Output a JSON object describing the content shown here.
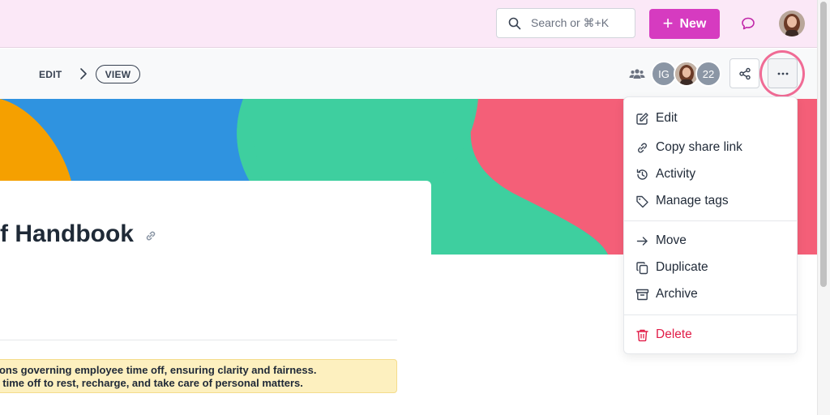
{
  "header": {
    "search_placeholder": "Search or ⌘+K",
    "new_label": "New"
  },
  "breadcrumb": {
    "edit_label": "EDIT",
    "view_label": "VIEW"
  },
  "collaborators": {
    "initials": "IG",
    "count": "22"
  },
  "document": {
    "title": "f Handbook",
    "callout_line1": "tions governing employee time off, ensuring clarity and fairness.",
    "callout_line2": "ir time off to rest, recharge, and take care of personal matters."
  },
  "menu": {
    "items": [
      {
        "label": "Edit",
        "icon": "pencil-square-icon"
      },
      {
        "label": "Copy share link",
        "icon": "link-icon"
      },
      {
        "label": "Activity",
        "icon": "history-icon"
      },
      {
        "label": "Manage tags",
        "icon": "tag-icon"
      },
      {
        "label": "Move",
        "icon": "arrow-right-icon"
      },
      {
        "label": "Duplicate",
        "icon": "duplicate-icon"
      },
      {
        "label": "Archive",
        "icon": "archive-icon"
      },
      {
        "label": "Delete",
        "icon": "trash-icon"
      }
    ]
  },
  "colors": {
    "brand_pink": "#d63bc0",
    "topbar_bg": "#fbe8f7",
    "banner_blue": "#2f93e0",
    "banner_green": "#3ecf9f",
    "banner_red": "#f45f78",
    "banner_orange": "#f5a000",
    "danger": "#e11d48",
    "callout_bg": "#fdf0bf",
    "highlight_ring": "#f06b95"
  }
}
